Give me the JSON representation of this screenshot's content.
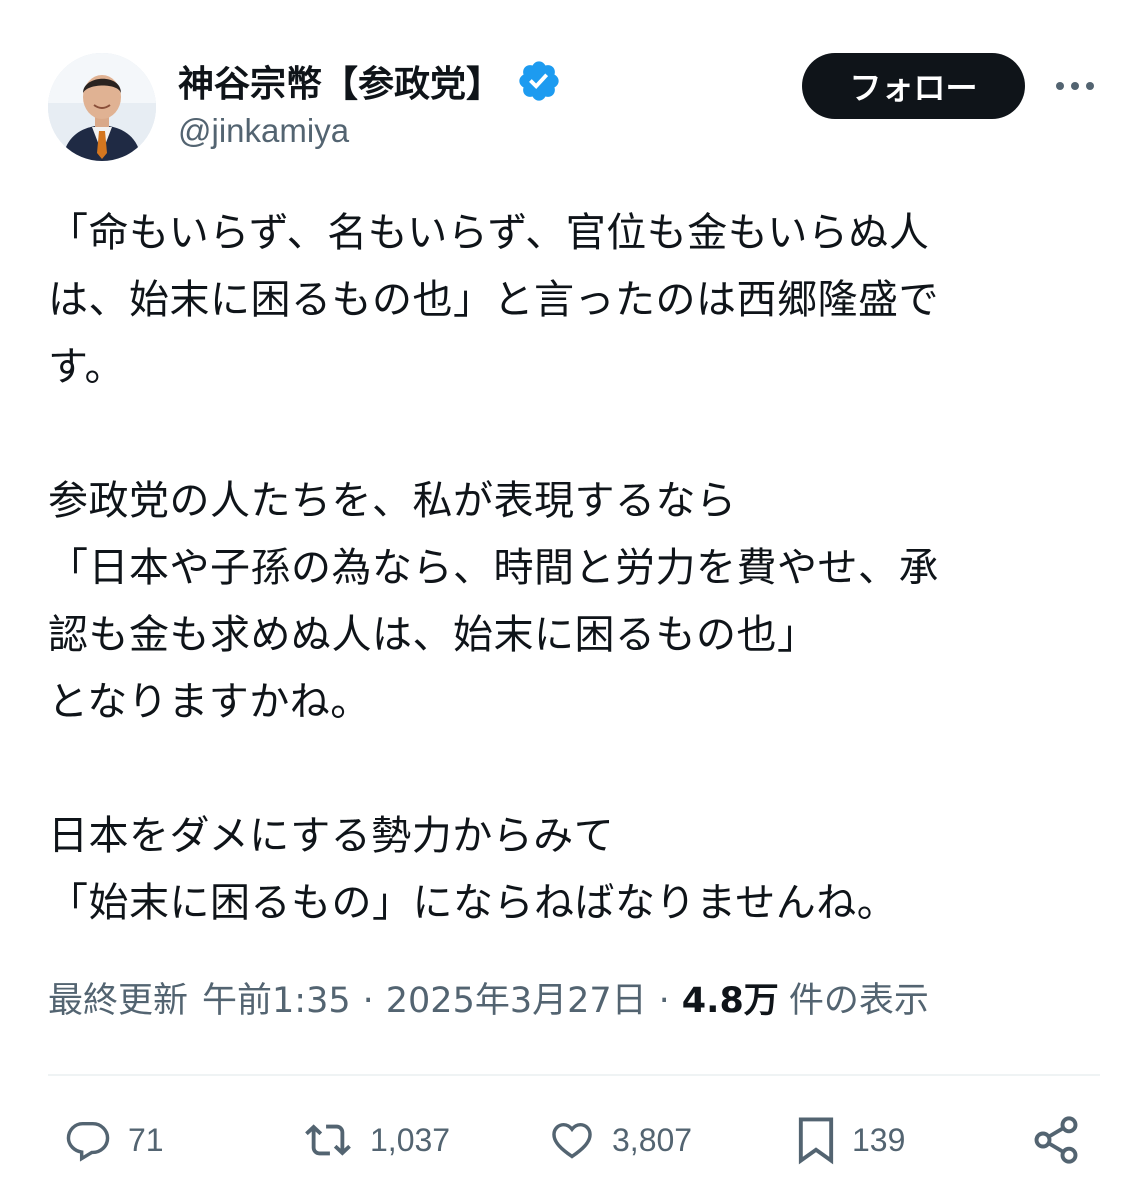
{
  "author": {
    "display_name": "神谷宗幣【参政党】",
    "handle": "@jinkamiya",
    "verified": true,
    "verified_color": "#1d9bf0"
  },
  "header": {
    "follow_label": "フォロー",
    "more_icon": "ellipsis-icon"
  },
  "tweet": {
    "text": "「命もいらず、名もいらず、官位も金もいらぬ人\nは、始末に困るもの也」と言ったのは西郷隆盛で\nす。\n\n参政党の人たちを、私が表現するなら\n「日本や子孫の為なら、時間と労力を費やせ、承\n認も金も求めぬ人は、始末に困るもの也」\nとなりますかね。\n\n日本をダメにする勢力からみて\n「始末に困るもの」にならねばなりませんね。"
  },
  "meta": {
    "updated_label": "最終更新",
    "time": "午前1:35",
    "separator": "·",
    "date": "2025年3月27日",
    "views_count": "4.8万",
    "views_label": "件の表示"
  },
  "actions": {
    "replies": {
      "icon": "reply-icon",
      "count": "71"
    },
    "reposts": {
      "icon": "repost-icon",
      "count": "1,037"
    },
    "likes": {
      "icon": "heart-icon",
      "count": "3,807"
    },
    "bookmarks": {
      "icon": "bookmark-icon",
      "count": "139"
    },
    "share": {
      "icon": "share-icon"
    }
  },
  "colors": {
    "text_primary": "#0f1419",
    "text_secondary": "#536471",
    "follow_bg": "#0f1419",
    "follow_text": "#ffffff"
  }
}
